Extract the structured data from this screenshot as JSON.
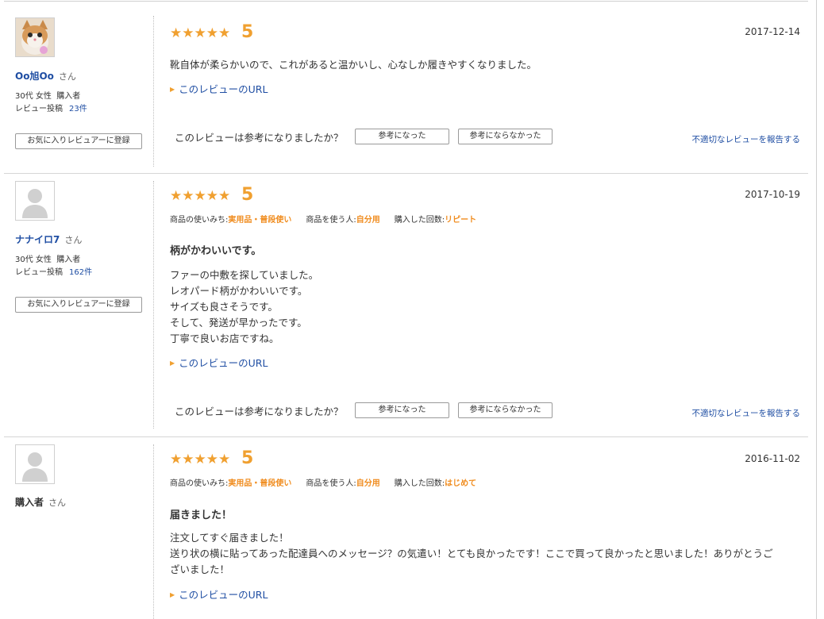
{
  "reviews": [
    {
      "avatar": "cat-photo-avatar",
      "name": "Oo旭Oo",
      "san": "さん",
      "age_gender": "30代 女性",
      "buyer": "購入者",
      "posts_label": "レビュー投稿",
      "posts_count": "23件",
      "fav_button": "お気に入りレビュアーに登録",
      "stars": "★★★★★",
      "rating": "5",
      "date": "2017-12-14",
      "body": "靴自体が柔らかいので、これがあると温かいし、心なしか履きやすくなりました。",
      "url_link": "このレビューのURL",
      "helpful_question": "このレビューは参考になりましたか？",
      "helpful_yes": "参考になった",
      "helpful_no": "参考にならなかった",
      "report": "不適切なレビューを報告する"
    },
    {
      "avatar": "default-person-avatar",
      "name": "ナナイロ7",
      "san": "さん",
      "age_gender": "30代 女性",
      "buyer": "購入者",
      "posts_label": "レビュー投稿",
      "posts_count": "162件",
      "fav_button": "お気に入りレビュアーに登録",
      "stars": "★★★★★",
      "rating": "5",
      "date": "2017-10-19",
      "usage_label": "商品の使いみち:",
      "usage_value": "実用品・普段使い",
      "user_label": "商品を使う人:",
      "user_value": "自分用",
      "count_label": "購入した回数:",
      "count_value": "リピート",
      "title": "柄がかわいいです。",
      "body_lines": [
        "ファーの中敷を探していました。",
        "レオパード柄がかわいいです。",
        "サイズも良さそうです。",
        "そして、発送が早かったです。",
        "丁寧で良いお店ですね。"
      ],
      "url_link": "このレビューのURL",
      "helpful_question": "このレビューは参考になりましたか？",
      "helpful_yes": "参考になった",
      "helpful_no": "参考にならなかった",
      "report": "不適切なレビューを報告する"
    },
    {
      "avatar": "default-person-avatar",
      "name": "購入者",
      "san": "さん",
      "stars": "★★★★★",
      "rating": "5",
      "date": "2016-11-02",
      "usage_label": "商品の使いみち:",
      "usage_value": "実用品・普段使い",
      "user_label": "商品を使う人:",
      "user_value": "自分用",
      "count_label": "購入した回数:",
      "count_value": "はじめて",
      "title": "届きました！",
      "body_lines": [
        "注文してすぐ届きました！",
        "送り状の横に貼ってあった配達員へのメッセージ？の気遣い！とても良かったです！ここで買って良かったと思いました！ありがとうご",
        "ざいました！"
      ],
      "url_link": "このレビューのURL"
    }
  ],
  "colors": {
    "accent_star": "#f0a030",
    "link": "#1f4ea3",
    "meta_value": "#f08c1e"
  }
}
